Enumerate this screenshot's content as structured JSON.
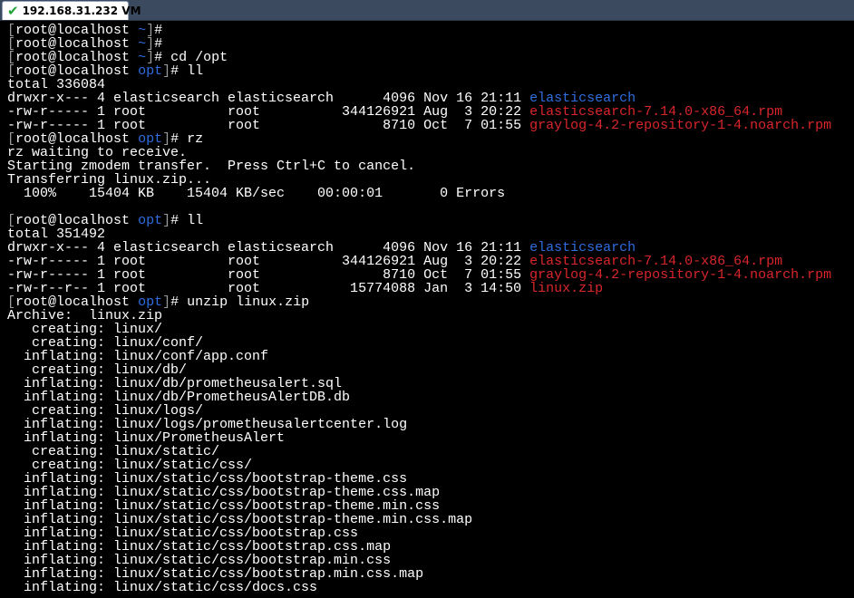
{
  "window": {
    "tab_title": "192.168.31.232 VM",
    "tab_icon": "check-icon"
  },
  "colors": {
    "background": "#000000",
    "text": "#ffffff",
    "bracket": "#9a9a9a",
    "directory": "#2f6de0",
    "archive_file": "#d8262c",
    "status_ok": "#22a33a"
  },
  "terminal": {
    "lines": [
      {
        "type": "prompt",
        "user": "root",
        "host": "localhost",
        "dir": "~",
        "cmd": ""
      },
      {
        "type": "prompt",
        "user": "root",
        "host": "localhost",
        "dir": "~",
        "cmd": ""
      },
      {
        "type": "prompt",
        "user": "root",
        "host": "localhost",
        "dir": "~",
        "cmd": " cd /opt"
      },
      {
        "type": "prompt",
        "user": "root",
        "host": "localhost",
        "dir": "opt",
        "cmd": " ll"
      },
      {
        "type": "text",
        "text": "total 336084"
      },
      {
        "type": "ls",
        "meta": "drwxr-x--- 4 elasticsearch elasticsearch      4096 Nov 16 21:11 ",
        "name": "elasticsearch",
        "kind": "dir"
      },
      {
        "type": "ls",
        "meta": "-rw-r----- 1 root          root          344126921 Aug  3 20:22 ",
        "name": "elasticsearch-7.14.0-x86_64.rpm",
        "kind": "rpm"
      },
      {
        "type": "ls",
        "meta": "-rw-r----- 1 root          root               8710 Oct  7 01:55 ",
        "name": "graylog-4.2-repository-1-4.noarch.rpm",
        "kind": "rpm"
      },
      {
        "type": "prompt",
        "user": "root",
        "host": "localhost",
        "dir": "opt",
        "cmd": " rz"
      },
      {
        "type": "text",
        "text": "rz waiting to receive."
      },
      {
        "type": "text",
        "text": "Starting zmodem transfer.  Press Ctrl+C to cancel."
      },
      {
        "type": "text",
        "text": "Transferring linux.zip..."
      },
      {
        "type": "text",
        "text": "  100%    15404 KB    15404 KB/sec    00:00:01       0 Errors"
      },
      {
        "type": "text",
        "text": ""
      },
      {
        "type": "prompt",
        "user": "root",
        "host": "localhost",
        "dir": "opt",
        "cmd": " ll"
      },
      {
        "type": "text",
        "text": "total 351492"
      },
      {
        "type": "ls",
        "meta": "drwxr-x--- 4 elasticsearch elasticsearch      4096 Nov 16 21:11 ",
        "name": "elasticsearch",
        "kind": "dir"
      },
      {
        "type": "ls",
        "meta": "-rw-r----- 1 root          root          344126921 Aug  3 20:22 ",
        "name": "elasticsearch-7.14.0-x86_64.rpm",
        "kind": "rpm"
      },
      {
        "type": "ls",
        "meta": "-rw-r----- 1 root          root               8710 Oct  7 01:55 ",
        "name": "graylog-4.2-repository-1-4.noarch.rpm",
        "kind": "rpm"
      },
      {
        "type": "ls",
        "meta": "-rw-r--r-- 1 root          root           15774088 Jan  3 14:50 ",
        "name": "linux.zip",
        "kind": "rpm"
      },
      {
        "type": "prompt",
        "user": "root",
        "host": "localhost",
        "dir": "opt",
        "cmd": " unzip linux.zip"
      },
      {
        "type": "text",
        "text": "Archive:  linux.zip"
      },
      {
        "type": "text",
        "text": "   creating: linux/"
      },
      {
        "type": "text",
        "text": "   creating: linux/conf/"
      },
      {
        "type": "text",
        "text": "  inflating: linux/conf/app.conf"
      },
      {
        "type": "text",
        "text": "   creating: linux/db/"
      },
      {
        "type": "text",
        "text": "  inflating: linux/db/prometheusalert.sql"
      },
      {
        "type": "text",
        "text": "  inflating: linux/db/PrometheusAlertDB.db"
      },
      {
        "type": "text",
        "text": "   creating: linux/logs/"
      },
      {
        "type": "text",
        "text": "  inflating: linux/logs/prometheusalertcenter.log"
      },
      {
        "type": "text",
        "text": "  inflating: linux/PrometheusAlert"
      },
      {
        "type": "text",
        "text": "   creating: linux/static/"
      },
      {
        "type": "text",
        "text": "   creating: linux/static/css/"
      },
      {
        "type": "text",
        "text": "  inflating: linux/static/css/bootstrap-theme.css"
      },
      {
        "type": "text",
        "text": "  inflating: linux/static/css/bootstrap-theme.css.map"
      },
      {
        "type": "text",
        "text": "  inflating: linux/static/css/bootstrap-theme.min.css"
      },
      {
        "type": "text",
        "text": "  inflating: linux/static/css/bootstrap-theme.min.css.map"
      },
      {
        "type": "text",
        "text": "  inflating: linux/static/css/bootstrap.css"
      },
      {
        "type": "text",
        "text": "  inflating: linux/static/css/bootstrap.css.map"
      },
      {
        "type": "text",
        "text": "  inflating: linux/static/css/bootstrap.min.css"
      },
      {
        "type": "text",
        "text": "  inflating: linux/static/css/bootstrap.min.css.map"
      },
      {
        "type": "text",
        "text": "  inflating: linux/static/css/docs.css"
      }
    ]
  }
}
